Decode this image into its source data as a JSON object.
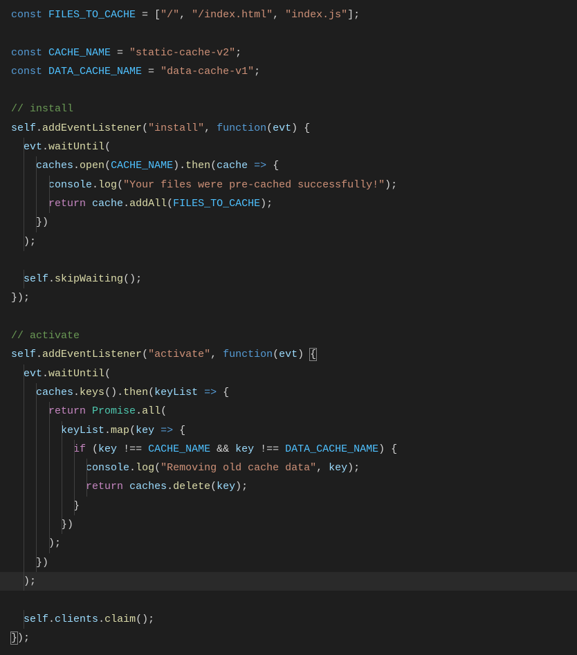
{
  "code": {
    "tokens": [
      [
        {
          "t": "const ",
          "c": "const-kw"
        },
        {
          "t": "FILES_TO_CACHE",
          "c": "const-name"
        },
        {
          "t": " = [",
          "c": "punct"
        },
        {
          "t": "\"/\"",
          "c": "string"
        },
        {
          "t": ", ",
          "c": "punct"
        },
        {
          "t": "\"/index.html\"",
          "c": "string"
        },
        {
          "t": ", ",
          "c": "punct"
        },
        {
          "t": "\"index.js\"",
          "c": "string"
        },
        {
          "t": "];",
          "c": "punct"
        }
      ],
      [],
      [
        {
          "t": "const ",
          "c": "const-kw"
        },
        {
          "t": "CACHE_NAME",
          "c": "const-name"
        },
        {
          "t": " = ",
          "c": "punct"
        },
        {
          "t": "\"static-cache-v2\"",
          "c": "string"
        },
        {
          "t": ";",
          "c": "punct"
        }
      ],
      [
        {
          "t": "const ",
          "c": "const-kw"
        },
        {
          "t": "DATA_CACHE_NAME",
          "c": "const-name"
        },
        {
          "t": " = ",
          "c": "punct"
        },
        {
          "t": "\"data-cache-v1\"",
          "c": "string"
        },
        {
          "t": ";",
          "c": "punct"
        }
      ],
      [],
      [
        {
          "t": "// install",
          "c": "comment"
        }
      ],
      [
        {
          "t": "self",
          "c": "var-name"
        },
        {
          "t": ".",
          "c": "punct"
        },
        {
          "t": "addEventListener",
          "c": "func-name"
        },
        {
          "t": "(",
          "c": "punct"
        },
        {
          "t": "\"install\"",
          "c": "string"
        },
        {
          "t": ", ",
          "c": "punct"
        },
        {
          "t": "function",
          "c": "const-kw"
        },
        {
          "t": "(",
          "c": "punct"
        },
        {
          "t": "evt",
          "c": "param"
        },
        {
          "t": ") {",
          "c": "punct"
        }
      ],
      [
        {
          "t": "  ",
          "c": "punct"
        },
        {
          "t": "evt",
          "c": "var-name"
        },
        {
          "t": ".",
          "c": "punct"
        },
        {
          "t": "waitUntil",
          "c": "func-name"
        },
        {
          "t": "(",
          "c": "punct"
        }
      ],
      [
        {
          "t": "    ",
          "c": "punct"
        },
        {
          "t": "caches",
          "c": "var-name"
        },
        {
          "t": ".",
          "c": "punct"
        },
        {
          "t": "open",
          "c": "func-name"
        },
        {
          "t": "(",
          "c": "punct"
        },
        {
          "t": "CACHE_NAME",
          "c": "const-name"
        },
        {
          "t": ").",
          "c": "punct"
        },
        {
          "t": "then",
          "c": "func-name"
        },
        {
          "t": "(",
          "c": "punct"
        },
        {
          "t": "cache",
          "c": "param"
        },
        {
          "t": " ",
          "c": "punct"
        },
        {
          "t": "=>",
          "c": "const-kw"
        },
        {
          "t": " {",
          "c": "punct"
        }
      ],
      [
        {
          "t": "      ",
          "c": "punct"
        },
        {
          "t": "console",
          "c": "var-name"
        },
        {
          "t": ".",
          "c": "punct"
        },
        {
          "t": "log",
          "c": "func-name"
        },
        {
          "t": "(",
          "c": "punct"
        },
        {
          "t": "\"Your files were pre-cached successfully!\"",
          "c": "string"
        },
        {
          "t": ");",
          "c": "punct"
        }
      ],
      [
        {
          "t": "      ",
          "c": "punct"
        },
        {
          "t": "return",
          "c": "kw"
        },
        {
          "t": " ",
          "c": "punct"
        },
        {
          "t": "cache",
          "c": "var-name"
        },
        {
          "t": ".",
          "c": "punct"
        },
        {
          "t": "addAll",
          "c": "func-name"
        },
        {
          "t": "(",
          "c": "punct"
        },
        {
          "t": "FILES_TO_CACHE",
          "c": "const-name"
        },
        {
          "t": ");",
          "c": "punct"
        }
      ],
      [
        {
          "t": "    })",
          "c": "punct"
        }
      ],
      [
        {
          "t": "  );",
          "c": "punct"
        }
      ],
      [],
      [
        {
          "t": "  ",
          "c": "punct"
        },
        {
          "t": "self",
          "c": "var-name"
        },
        {
          "t": ".",
          "c": "punct"
        },
        {
          "t": "skipWaiting",
          "c": "func-name"
        },
        {
          "t": "();",
          "c": "punct"
        }
      ],
      [
        {
          "t": "});",
          "c": "punct"
        }
      ],
      [],
      [
        {
          "t": "// activate",
          "c": "comment"
        }
      ],
      [
        {
          "t": "self",
          "c": "var-name"
        },
        {
          "t": ".",
          "c": "punct"
        },
        {
          "t": "addEventListener",
          "c": "func-name"
        },
        {
          "t": "(",
          "c": "punct"
        },
        {
          "t": "\"activate\"",
          "c": "string"
        },
        {
          "t": ", ",
          "c": "punct"
        },
        {
          "t": "function",
          "c": "const-kw"
        },
        {
          "t": "(",
          "c": "punct"
        },
        {
          "t": "evt",
          "c": "param"
        },
        {
          "t": ") ",
          "c": "punct"
        },
        {
          "t": "{",
          "c": "punct",
          "box": true
        }
      ],
      [
        {
          "t": "  ",
          "c": "punct"
        },
        {
          "t": "evt",
          "c": "var-name"
        },
        {
          "t": ".",
          "c": "punct"
        },
        {
          "t": "waitUntil",
          "c": "func-name"
        },
        {
          "t": "(",
          "c": "punct"
        }
      ],
      [
        {
          "t": "    ",
          "c": "punct"
        },
        {
          "t": "caches",
          "c": "var-name"
        },
        {
          "t": ".",
          "c": "punct"
        },
        {
          "t": "keys",
          "c": "func-name"
        },
        {
          "t": "().",
          "c": "punct"
        },
        {
          "t": "then",
          "c": "func-name"
        },
        {
          "t": "(",
          "c": "punct"
        },
        {
          "t": "keyList",
          "c": "param"
        },
        {
          "t": " ",
          "c": "punct"
        },
        {
          "t": "=>",
          "c": "const-kw"
        },
        {
          "t": " {",
          "c": "punct"
        }
      ],
      [
        {
          "t": "      ",
          "c": "punct"
        },
        {
          "t": "return",
          "c": "kw"
        },
        {
          "t": " ",
          "c": "punct"
        },
        {
          "t": "Promise",
          "c": "type"
        },
        {
          "t": ".",
          "c": "punct"
        },
        {
          "t": "all",
          "c": "func-name"
        },
        {
          "t": "(",
          "c": "punct"
        }
      ],
      [
        {
          "t": "        ",
          "c": "punct"
        },
        {
          "t": "keyList",
          "c": "var-name"
        },
        {
          "t": ".",
          "c": "punct"
        },
        {
          "t": "map",
          "c": "func-name"
        },
        {
          "t": "(",
          "c": "punct"
        },
        {
          "t": "key",
          "c": "param"
        },
        {
          "t": " ",
          "c": "punct"
        },
        {
          "t": "=>",
          "c": "const-kw"
        },
        {
          "t": " {",
          "c": "punct"
        }
      ],
      [
        {
          "t": "          ",
          "c": "punct"
        },
        {
          "t": "if",
          "c": "kw"
        },
        {
          "t": " (",
          "c": "punct"
        },
        {
          "t": "key",
          "c": "var-name"
        },
        {
          "t": " !== ",
          "c": "punct"
        },
        {
          "t": "CACHE_NAME",
          "c": "const-name"
        },
        {
          "t": " && ",
          "c": "punct"
        },
        {
          "t": "key",
          "c": "var-name"
        },
        {
          "t": " !== ",
          "c": "punct"
        },
        {
          "t": "DATA_CACHE_NAME",
          "c": "const-name"
        },
        {
          "t": ") {",
          "c": "punct"
        }
      ],
      [
        {
          "t": "            ",
          "c": "punct"
        },
        {
          "t": "console",
          "c": "var-name"
        },
        {
          "t": ".",
          "c": "punct"
        },
        {
          "t": "log",
          "c": "func-name"
        },
        {
          "t": "(",
          "c": "punct"
        },
        {
          "t": "\"Removing old cache data\"",
          "c": "string"
        },
        {
          "t": ", ",
          "c": "punct"
        },
        {
          "t": "key",
          "c": "var-name"
        },
        {
          "t": ");",
          "c": "punct"
        }
      ],
      [
        {
          "t": "            ",
          "c": "punct"
        },
        {
          "t": "return",
          "c": "kw"
        },
        {
          "t": " ",
          "c": "punct"
        },
        {
          "t": "caches",
          "c": "var-name"
        },
        {
          "t": ".",
          "c": "punct"
        },
        {
          "t": "delete",
          "c": "func-name"
        },
        {
          "t": "(",
          "c": "punct"
        },
        {
          "t": "key",
          "c": "var-name"
        },
        {
          "t": ");",
          "c": "punct"
        }
      ],
      [
        {
          "t": "          }",
          "c": "punct"
        }
      ],
      [
        {
          "t": "        })",
          "c": "punct"
        }
      ],
      [
        {
          "t": "      );",
          "c": "punct"
        }
      ],
      [
        {
          "t": "    })",
          "c": "punct"
        }
      ],
      [
        {
          "t": "  );",
          "c": "punct",
          "current": true
        }
      ],
      [],
      [
        {
          "t": "  ",
          "c": "punct"
        },
        {
          "t": "self",
          "c": "var-name"
        },
        {
          "t": ".",
          "c": "punct"
        },
        {
          "t": "clients",
          "c": "var-name"
        },
        {
          "t": ".",
          "c": "punct"
        },
        {
          "t": "claim",
          "c": "func-name"
        },
        {
          "t": "();",
          "c": "punct"
        }
      ],
      [
        {
          "t": "}",
          "c": "punct",
          "box": true
        },
        {
          "t": ");",
          "c": "punct"
        }
      ]
    ],
    "current_line_index": 30,
    "indent_guides": {
      "7": [
        1
      ],
      "8": [
        1,
        2
      ],
      "9": [
        1,
        2,
        3
      ],
      "10": [
        1,
        2,
        3
      ],
      "11": [
        1,
        2
      ],
      "12": [
        1
      ],
      "14": [
        1
      ],
      "19": [
        1
      ],
      "20": [
        1,
        2
      ],
      "21": [
        1,
        2,
        3
      ],
      "22": [
        1,
        2,
        3,
        4
      ],
      "23": [
        1,
        2,
        3,
        4,
        5
      ],
      "24": [
        1,
        2,
        3,
        4,
        5,
        6
      ],
      "25": [
        1,
        2,
        3,
        4,
        5,
        6
      ],
      "26": [
        1,
        2,
        3,
        4,
        5
      ],
      "27": [
        1,
        2,
        3,
        4
      ],
      "28": [
        1,
        2,
        3
      ],
      "29": [
        1,
        2
      ],
      "30": [
        1
      ],
      "32": [
        1
      ]
    }
  }
}
